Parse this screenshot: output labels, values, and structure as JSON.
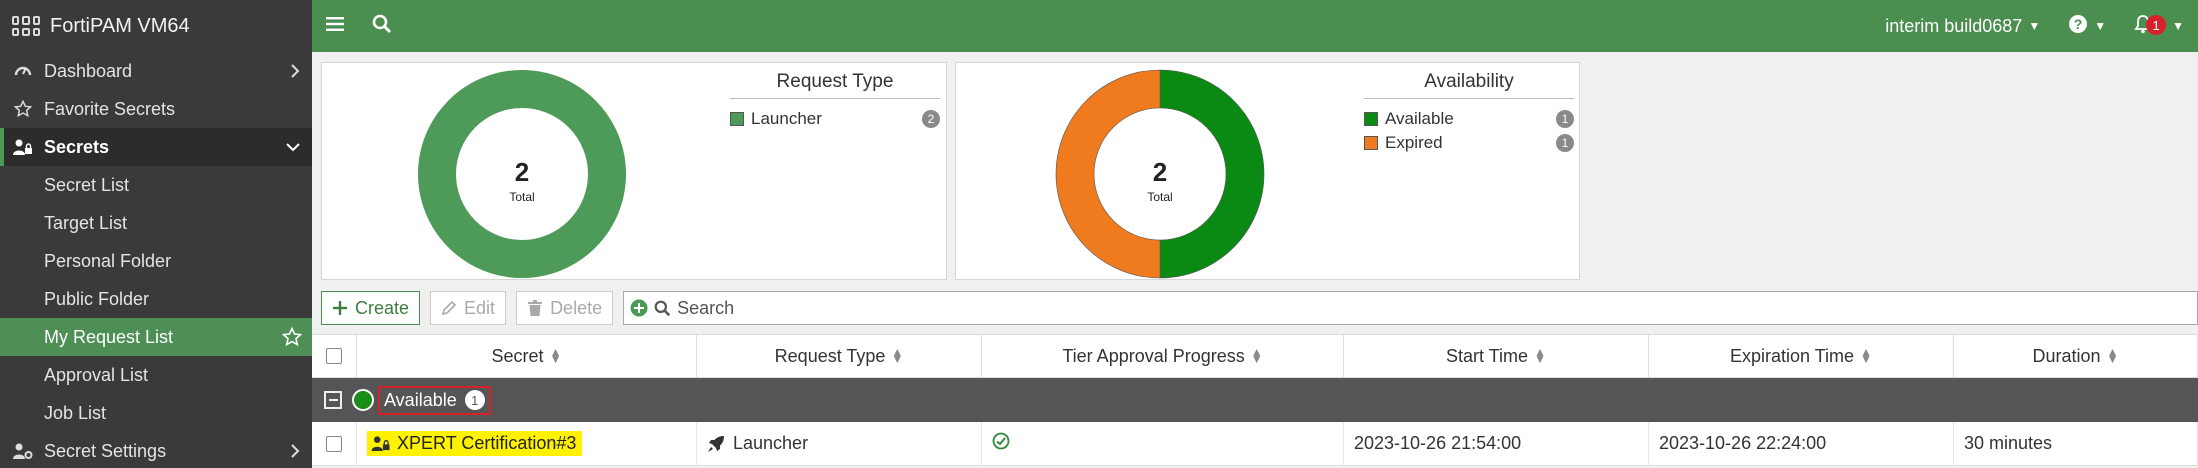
{
  "sidebar": {
    "brand": "FortiPAM VM64",
    "items": [
      {
        "label": "Dashboard"
      },
      {
        "label": "Favorite Secrets"
      },
      {
        "label": "Secrets"
      },
      {
        "label": "Secret List"
      },
      {
        "label": "Target List"
      },
      {
        "label": "Personal Folder"
      },
      {
        "label": "Public Folder"
      },
      {
        "label": "My Request List"
      },
      {
        "label": "Approval List"
      },
      {
        "label": "Job List"
      },
      {
        "label": "Secret Settings"
      }
    ]
  },
  "topbar": {
    "build": "interim build0687",
    "notifications": "1"
  },
  "widgets": {
    "request_type": {
      "total": "2",
      "total_label": "Total",
      "title": "Request Type",
      "legend": [
        {
          "label": "Launcher",
          "count": "2"
        }
      ]
    },
    "availability": {
      "total": "2",
      "total_label": "Total",
      "title": "Availability",
      "legend": [
        {
          "label": "Available",
          "count": "1"
        },
        {
          "label": "Expired",
          "count": "1"
        }
      ]
    }
  },
  "chart_data": [
    {
      "type": "pie",
      "categories": [
        "Launcher"
      ],
      "values": [
        2
      ],
      "title": "Request Type",
      "colors": [
        "#4e9a58"
      ]
    },
    {
      "type": "pie",
      "categories": [
        "Available",
        "Expired"
      ],
      "values": [
        1,
        1
      ],
      "title": "Availability",
      "colors": [
        "#0a8a12",
        "#f07a1e"
      ]
    }
  ],
  "toolbar": {
    "create": "Create",
    "edit": "Edit",
    "delete": "Delete",
    "search_placeholder": "Search"
  },
  "table": {
    "headers": [
      "Secret",
      "Request Type",
      "Tier Approval Progress",
      "Start Time",
      "Expiration Time",
      "Duration"
    ],
    "group": {
      "label": "Available",
      "count": "1"
    },
    "rows": [
      {
        "secret": "XPERT Certification#3",
        "request_type": "Launcher",
        "start": "2023-10-26 21:54:00",
        "expiration": "2023-10-26 22:24:00",
        "duration": "30 minutes"
      }
    ]
  },
  "colors": {
    "accent": "#4a8f4f",
    "sidebar": "#3a3a3a",
    "highlight": "#fff200",
    "alert": "#d9212c"
  }
}
